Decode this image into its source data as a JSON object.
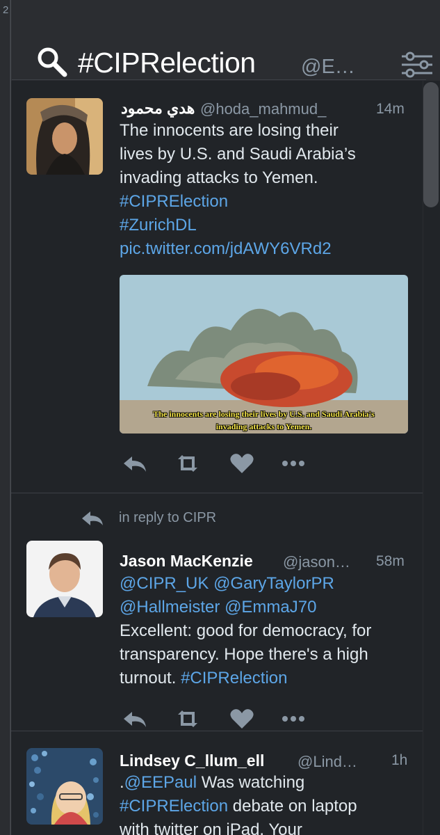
{
  "column_number": "2",
  "header": {
    "title": "#CIPRelection",
    "subtitle": "@E…"
  },
  "tweets": [
    {
      "display_name": "هدي محمود",
      "handle": "@hoda_mahmud_",
      "time": "14m",
      "lines": [
        "The innocents are losing their",
        "lives by U.S. and Saudi Arabia’s",
        "invading attacks to Yemen."
      ],
      "links": [
        "#CIPRElection",
        "#ZurichDL",
        "pic.twitter.com/jdAWY6VRd2"
      ],
      "media_caption": [
        "The innocents are losing their lives by U.S. and Saudi Arabia's",
        "invading attacks to Yemen."
      ]
    },
    {
      "reply_context": "in reply to CIPR",
      "display_name": "Jason MacKenzie",
      "handle": "@jason…",
      "time": "58m",
      "mentions_line1": [
        "@CIPR_UK",
        "@GaryTaylorPR"
      ],
      "mentions_line2": [
        "@Hallmeister",
        "@EmmaJ70"
      ],
      "lines": [
        "Excellent: good for democracy, for",
        "transparency. Hope there's a high",
        "turnout."
      ],
      "hashtag": "#CIPRelection"
    },
    {
      "display_name": "Lindsey C_llum_ell",
      "handle": "@Lind…",
      "time": "1h",
      "line1_prefix": ".",
      "line1_mention": "@EEPaul",
      "line1_rest": "Was watching",
      "line2_hashtag": "#CIPRElection",
      "line2_rest": "debate on laptop",
      "line3": "with twitter on iPad. Your"
    }
  ],
  "icons": {
    "search": "search-icon",
    "filter": "filter-settings-icon",
    "reply": "reply-icon",
    "retweet": "retweet-icon",
    "like": "heart-icon",
    "more": "more-icon"
  },
  "colors": {
    "link": "#5da6e7",
    "background": "#212428",
    "text": "#e1e8ed",
    "muted": "#8b98a5"
  }
}
